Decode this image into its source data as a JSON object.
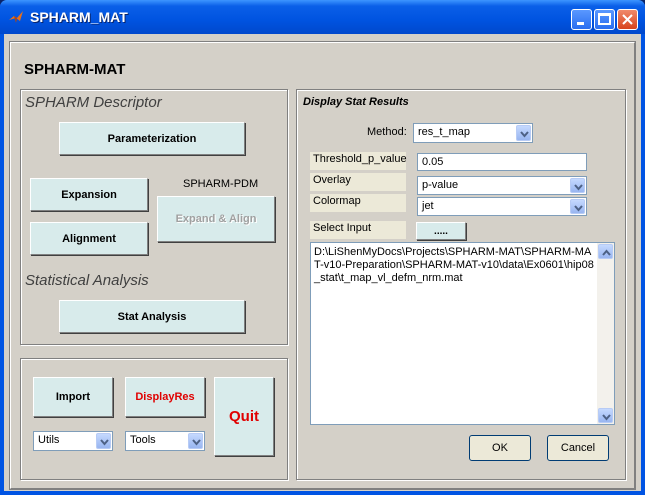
{
  "window": {
    "title": "SPHARM_MAT"
  },
  "app": {
    "title": "SPHARM-MAT"
  },
  "descriptor": {
    "label": "SPHARM Descriptor",
    "parameterization": "Parameterization",
    "expansion": "Expansion",
    "alignment": "Alignment",
    "pdm_label": "SPHARM-PDM",
    "expand_align": "Expand & Align",
    "stat_label": "Statistical Analysis",
    "stat_analysis": "Stat Analysis"
  },
  "bottom": {
    "import": "Import",
    "display_res": "DisplayRes",
    "quit": "Quit",
    "utils": "Utils",
    "tools": "Tools"
  },
  "display": {
    "title": "Display Stat Results",
    "method_label": "Method:",
    "method_value": "res_t_map",
    "threshold_label": "Threshold_p_value",
    "threshold_value": "0.05",
    "overlay_label": "Overlay",
    "overlay_value": "p-value",
    "colormap_label": "Colormap",
    "colormap_value": "jet",
    "select_input_label": "Select Input",
    "browse_label": ".....",
    "input_path": "D:\\LiShenMyDocs\\Projects\\SPHARM-MAT\\SPHARM-MAT-v10-Preparation\\SPHARM-MAT-v10\\data\\Ex0601\\hip08_stat\\t_map_vl_defm_nrm.mat",
    "ok": "OK",
    "cancel": "Cancel"
  },
  "colors": {
    "button_face": "#d8ebeb",
    "quit_text": "#e00000",
    "titlebar": "#0054e3"
  }
}
